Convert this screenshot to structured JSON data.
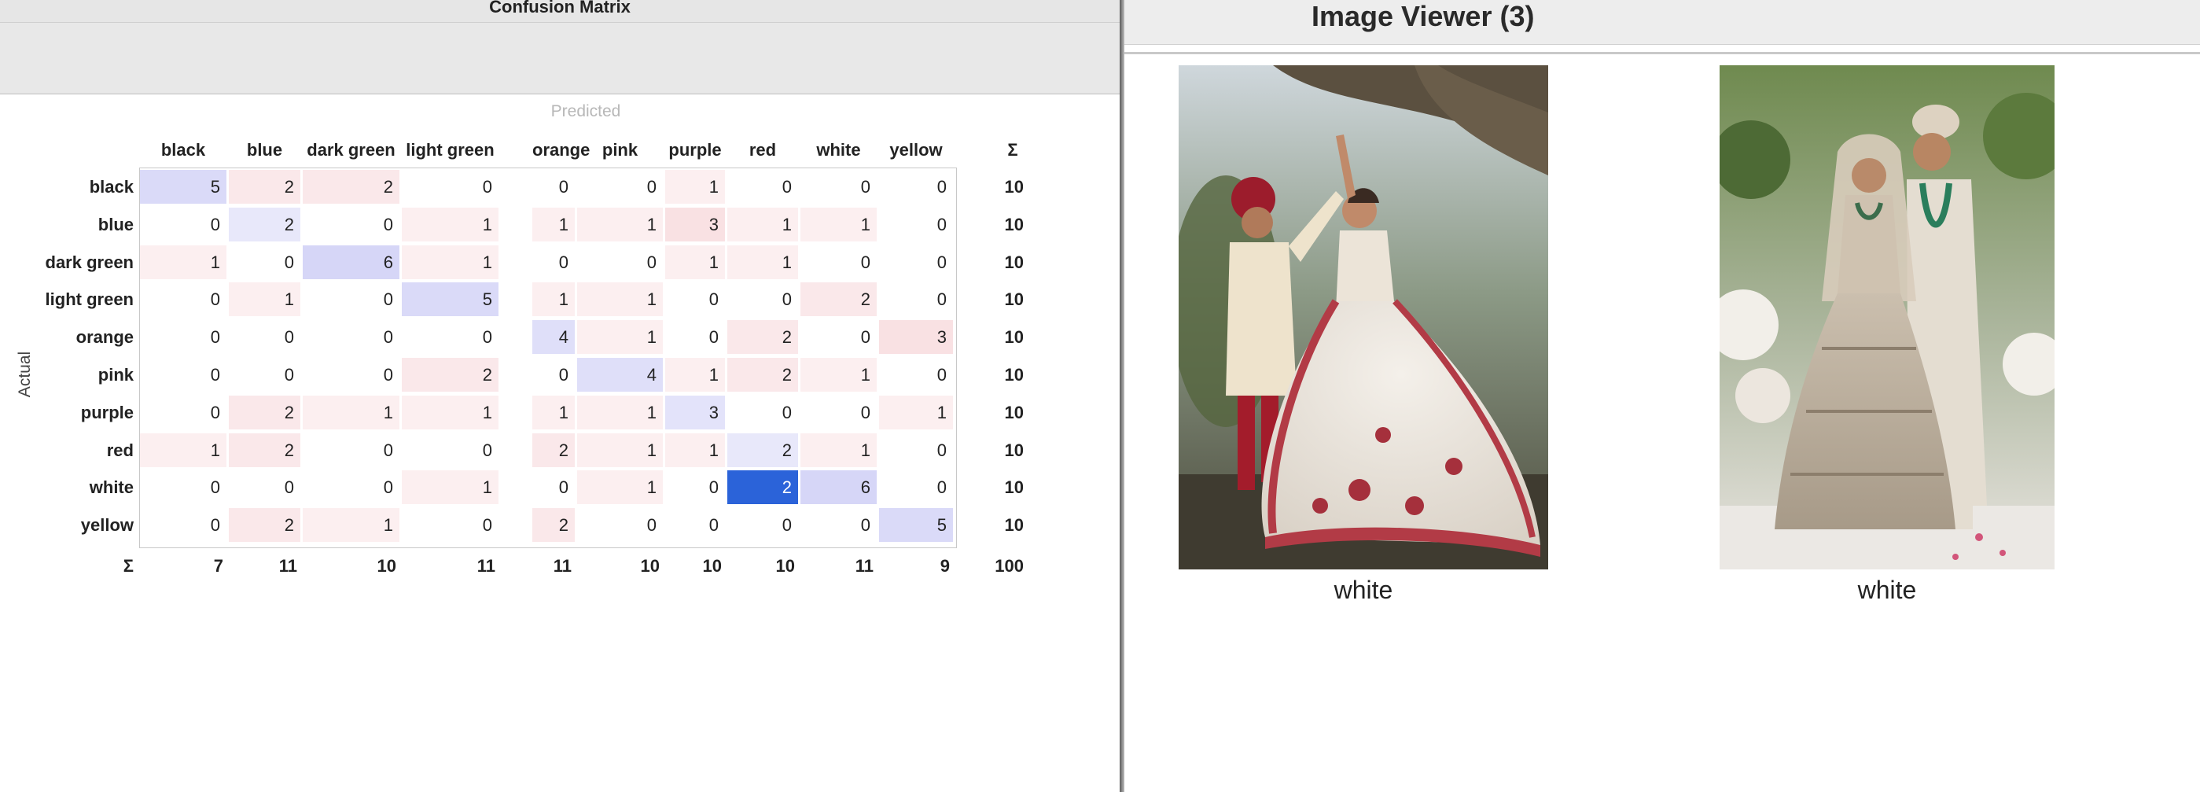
{
  "confusion_window": {
    "title": "Confusion Matrix",
    "predicted_label": "Predicted",
    "actual_label": "Actual",
    "sum_symbol": "Σ",
    "classes": [
      "black",
      "blue",
      "dark green",
      "light green",
      "orange",
      "pink",
      "purple",
      "red",
      "white",
      "yellow"
    ],
    "matrix": [
      [
        5,
        2,
        2,
        0,
        0,
        0,
        1,
        0,
        0,
        0
      ],
      [
        0,
        2,
        0,
        1,
        1,
        1,
        3,
        1,
        1,
        0
      ],
      [
        1,
        0,
        6,
        1,
        0,
        0,
        1,
        1,
        0,
        0
      ],
      [
        0,
        1,
        0,
        5,
        1,
        1,
        0,
        0,
        2,
        0
      ],
      [
        0,
        0,
        0,
        0,
        4,
        1,
        0,
        2,
        0,
        3
      ],
      [
        0,
        0,
        0,
        2,
        0,
        4,
        1,
        2,
        1,
        0
      ],
      [
        0,
        2,
        1,
        1,
        1,
        1,
        3,
        0,
        0,
        1
      ],
      [
        1,
        2,
        0,
        0,
        2,
        1,
        1,
        2,
        1,
        0
      ],
      [
        0,
        0,
        0,
        1,
        0,
        1,
        0,
        2,
        6,
        0
      ],
      [
        0,
        2,
        1,
        0,
        2,
        0,
        0,
        0,
        0,
        5
      ]
    ],
    "row_sums": [
      "10",
      "10",
      "10",
      "10",
      "10",
      "10",
      "10",
      "10",
      "10",
      "10"
    ],
    "col_sums": [
      "7",
      "11",
      "10",
      "11",
      "11",
      "10",
      "10",
      "10",
      "11",
      "9"
    ],
    "total": "100",
    "selected_cell": {
      "row": 8,
      "col": 7
    },
    "colors": {
      "diagonal": "#d6d6f7",
      "off_diagonal": "#f9e1e3",
      "selected": "#2b63d9",
      "selected_text": "#ffffff"
    }
  },
  "image_viewer": {
    "title": "Image Viewer (3)",
    "images": [
      {
        "caption": "white"
      },
      {
        "caption": "white"
      }
    ]
  }
}
